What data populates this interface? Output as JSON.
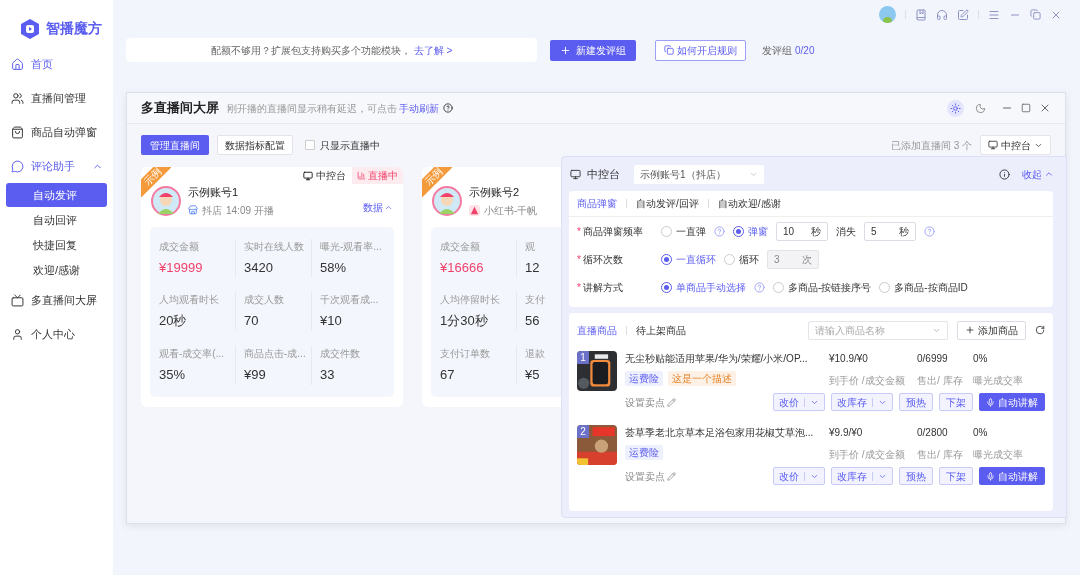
{
  "app": {
    "name": "智播魔方"
  },
  "sidebar": {
    "items": [
      {
        "label": "首页",
        "highlighted": true,
        "selected": false
      },
      {
        "label": "直播间管理",
        "highlighted": false,
        "selected": false
      },
      {
        "label": "商品自动弹窗",
        "highlighted": false,
        "selected": false
      },
      {
        "label": "评论助手",
        "highlighted": true,
        "selected": false,
        "expanded": true,
        "children": [
          {
            "label": "自动发评",
            "selected": true
          },
          {
            "label": "自动回评",
            "selected": false
          },
          {
            "label": "快捷回复",
            "selected": false
          },
          {
            "label": "欢迎/感谢",
            "selected": false
          }
        ]
      },
      {
        "label": "多直播间大屏",
        "highlighted": false,
        "selected": false
      },
      {
        "label": "个人中心",
        "highlighted": false,
        "selected": false
      }
    ]
  },
  "notice": {
    "text": "配额不够用？扩展包支持购买多个功能模块，",
    "link": "去了解 >"
  },
  "toolbar": {
    "new_button": "新建发评组",
    "rules_button": "如何开启规则",
    "counter_label": "发评组",
    "counter": "0/20"
  },
  "window": {
    "title": "多直播间大屏",
    "subtitle": "刚开播的直播间显示稍有延迟，可点击",
    "refresh_link": "手动刷新",
    "theme_toggle": [
      {
        "selected": true
      },
      {
        "selected": false
      }
    ],
    "actions": {
      "manage": "管理直播间",
      "config": "数据指标配置",
      "live_only": {
        "label": "只显示直播中",
        "checked": false
      },
      "added": "已添加直播间 3 个",
      "console": "中控台"
    },
    "cards": [
      {
        "badge": "示例",
        "name": "示例账号1",
        "platform": "抖店",
        "time": "14:09 开播",
        "console": "中控台",
        "live": "直播中",
        "toggle": "数据",
        "expanded": true,
        "rows": [
          [
            {
              "label": "成交金额",
              "value": "¥19999",
              "highlight": true
            },
            {
              "label": "实时在线人数",
              "value": "3420",
              "highlight": false
            },
            {
              "label": "曝光-观看率...",
              "value": "58%",
              "highlight": false
            }
          ],
          [
            {
              "label": "人均观看时长",
              "value": "20秒",
              "highlight": false
            },
            {
              "label": "成交人数",
              "value": "70",
              "highlight": false
            },
            {
              "label": "千次观看成...",
              "value": "¥10",
              "highlight": false
            }
          ],
          [
            {
              "label": "观看-成交率(...",
              "value": "35%",
              "highlight": false
            },
            {
              "label": "商品点击-成...",
              "value": "¥99",
              "highlight": false
            },
            {
              "label": "成交件数",
              "value": "33",
              "highlight": false
            }
          ]
        ]
      },
      {
        "badge": "示例",
        "name": "示例账号2",
        "platform": "小红书-千帆",
        "rows": [
          [
            {
              "label": "成交金额",
              "value": "¥16666",
              "highlight": true
            },
            {
              "label": "观",
              "value": "12",
              "highlight": false
            }
          ],
          [
            {
              "label": "人均停留时长",
              "value": "1分30秒",
              "highlight": false
            },
            {
              "label": "支付",
              "value": "56",
              "highlight": false
            }
          ],
          [
            {
              "label": "支付订单数",
              "value": "67",
              "highlight": false
            },
            {
              "label": "退款",
              "value": "¥5",
              "highlight": false
            }
          ]
        ]
      }
    ]
  },
  "panel": {
    "title": "中控台",
    "account": "示例账号1（抖店）",
    "collapse": "收起",
    "tabs": [
      {
        "label": "商品弹窗",
        "selected": true
      },
      {
        "label": "自动发评/回评",
        "selected": false
      },
      {
        "label": "自动欢迎/感谢",
        "selected": false
      }
    ],
    "form": [
      {
        "mark": "*",
        "label": "商品弹窗频率",
        "controls": [
          {
            "kind": "radio",
            "label": "一直弹",
            "selected": false
          },
          {
            "kind": "help"
          },
          {
            "kind": "radio",
            "label": "弹窗",
            "selected": true
          },
          {
            "kind": "input",
            "value": "10",
            "unit": "秒",
            "disabled": false
          },
          {
            "kind": "text",
            "text": "消失"
          },
          {
            "kind": "input",
            "value": "5",
            "unit": "秒",
            "disabled": false
          },
          {
            "kind": "help"
          }
        ]
      },
      {
        "mark": "*",
        "label": "循环次数",
        "controls": [
          {
            "kind": "radio",
            "label": "一直循环",
            "selected": true
          },
          {
            "kind": "radio",
            "label": "循环",
            "selected": false
          },
          {
            "kind": "input",
            "value": "3",
            "unit": "次",
            "disabled": true
          }
        ]
      },
      {
        "mark": "*",
        "label": "讲解方式",
        "controls": [
          {
            "kind": "radio",
            "label": "单商品手动选择",
            "selected": true
          },
          {
            "kind": "help"
          },
          {
            "kind": "radio",
            "label": "多商品-按链接序号",
            "selected": false
          },
          {
            "kind": "radio",
            "label": "多商品-按商品ID",
            "selected": false
          }
        ]
      }
    ],
    "products": {
      "tabs": [
        {
          "label": "直播商品",
          "selected": true
        },
        {
          "label": "待上架商品",
          "selected": false
        }
      ],
      "search_placeholder": "请输入商品名称",
      "add_button": "添加商品",
      "items": [
        {
          "index": "1",
          "title": "无尘秒贴能适用苹果/华为/荣耀/小米/OP...",
          "tags": [
            {
              "text": "运费险",
              "kind": "blue"
            },
            {
              "text": "这是一个描述",
              "kind": "orange"
            }
          ],
          "price": "¥10.9/¥0",
          "price_label": "到手价 /成交金额",
          "stock": "0/6999",
          "stock_label": "售出/ 库存",
          "rate": "0%",
          "rate_label": "曝光成交率",
          "selling_point": "设置卖点",
          "buttons": [
            {
              "label": "改价",
              "kind": "split"
            },
            {
              "label": "改库存",
              "kind": "split"
            },
            {
              "label": "预热",
              "kind": "plain"
            },
            {
              "label": "下架",
              "kind": "plain"
            },
            {
              "label": "自动讲解",
              "kind": "primary"
            }
          ]
        },
        {
          "index": "2",
          "title": "荟草季老北京草本足浴包家用花椒艾草泡...",
          "tags": [
            {
              "text": "运费险",
              "kind": "blue"
            }
          ],
          "price": "¥9.9/¥0",
          "price_label": "到手价 /成交金额",
          "stock": "0/2800",
          "stock_label": "售出/ 库存",
          "rate": "0%",
          "rate_label": "曝光成交率",
          "selling_point": "设置卖点",
          "buttons": [
            {
              "label": "改价",
              "kind": "split"
            },
            {
              "label": "改库存",
              "kind": "split"
            },
            {
              "label": "预热",
              "kind": "plain"
            },
            {
              "label": "下架",
              "kind": "plain"
            },
            {
              "label": "自动讲解",
              "kind": "primary"
            }
          ]
        }
      ]
    }
  }
}
